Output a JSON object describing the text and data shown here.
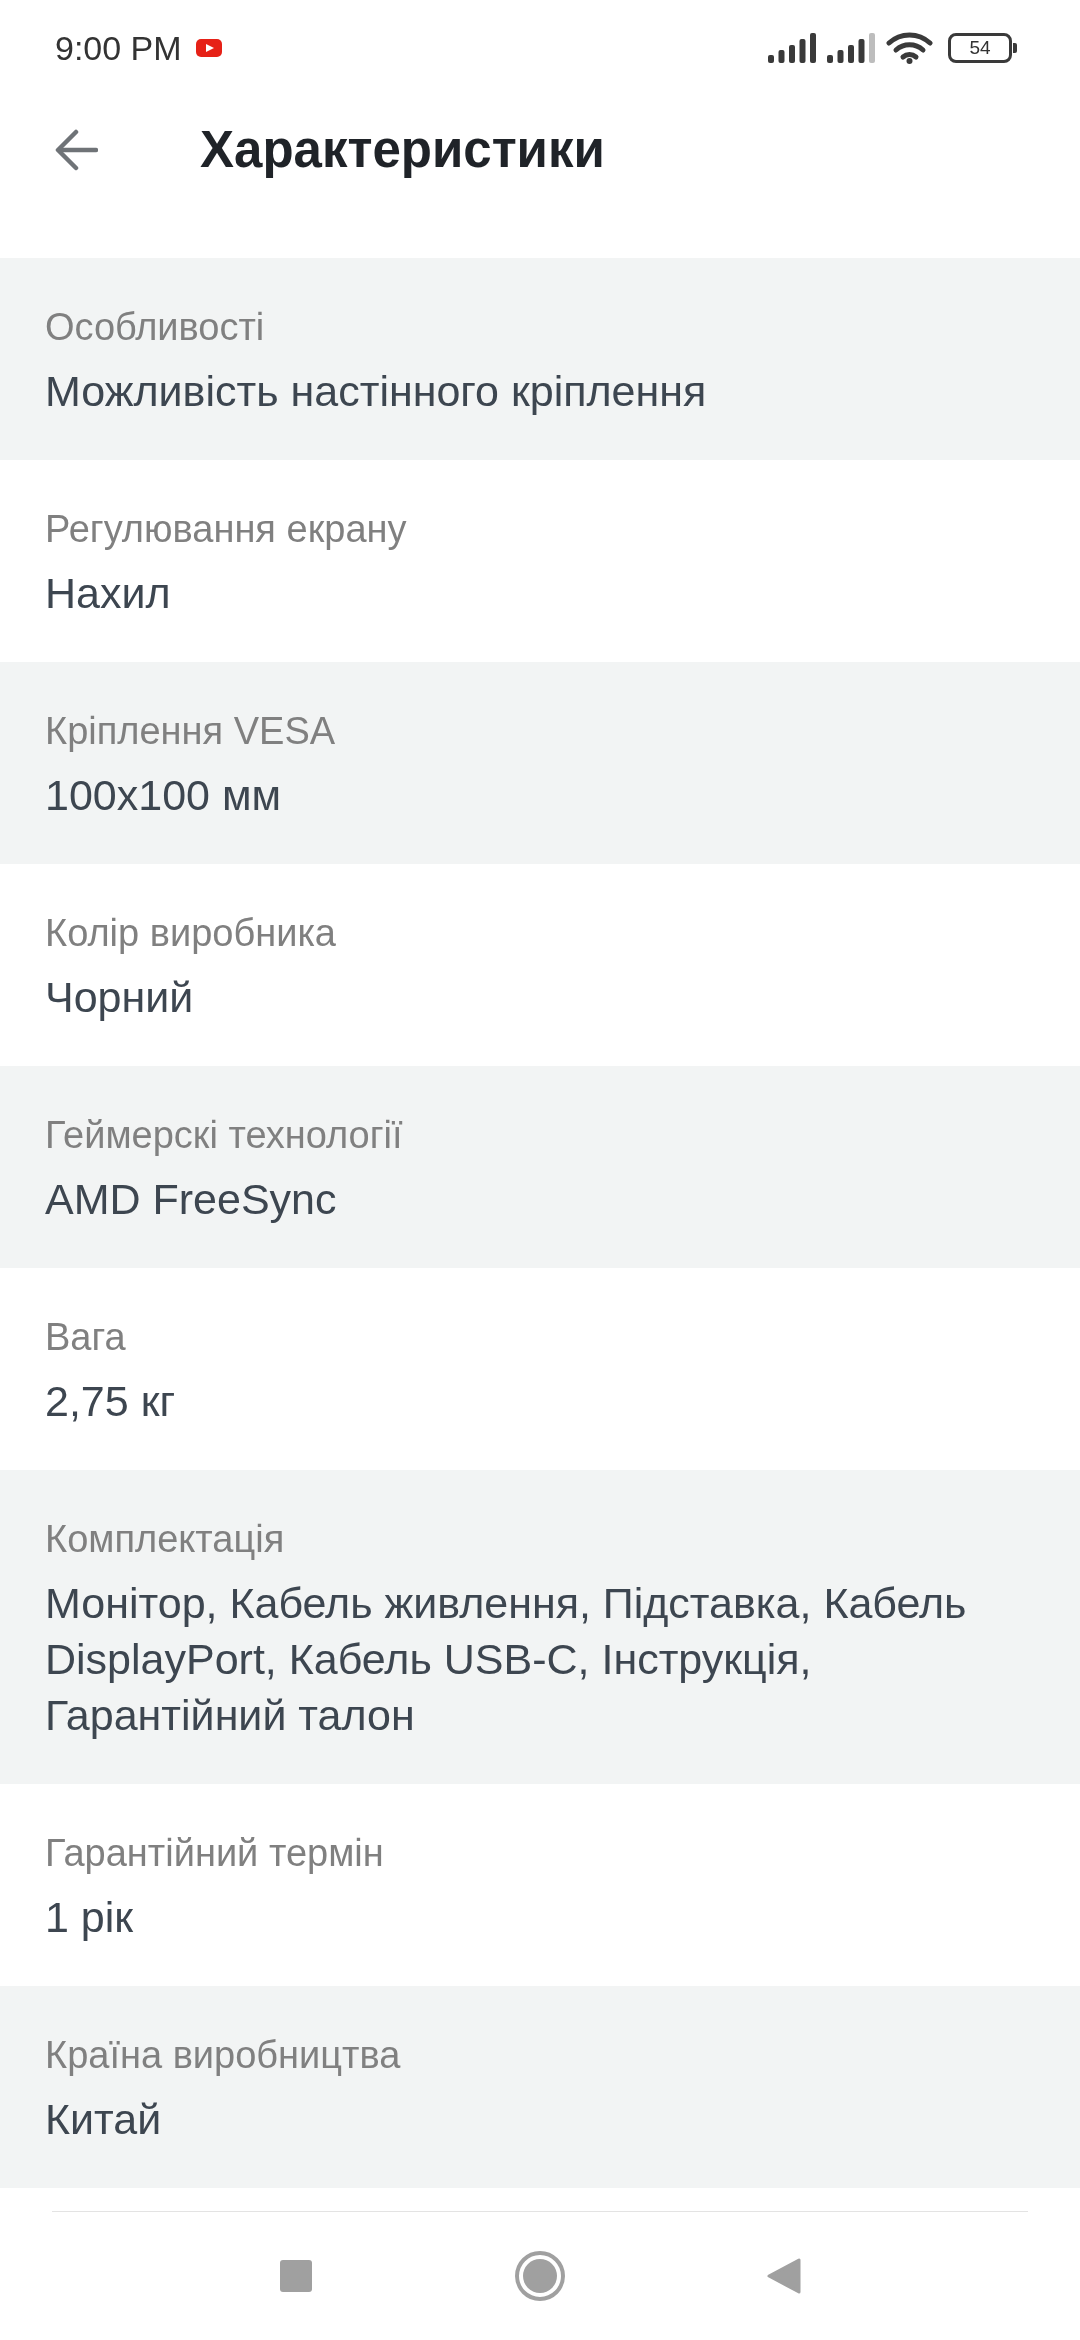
{
  "status_bar": {
    "time": "9:00 PM",
    "battery": "54"
  },
  "header": {
    "title": "Характеристики"
  },
  "specs": [
    {
      "label": "Особливості",
      "value": "Можливість настінного кріплення"
    },
    {
      "label": "Регулювання екрану",
      "value": "Нахил"
    },
    {
      "label": "Кріплення VESA",
      "value": "100x100 мм"
    },
    {
      "label": "Колір виробника",
      "value": "Чорний"
    },
    {
      "label": "Геймерскі технології",
      "value": "AMD FreeSync"
    },
    {
      "label": "Вага",
      "value": "2,75 кг"
    },
    {
      "label": "Комплектація",
      "value": "Монітор, Кабель живлення, Підставка, Кабель DisplayPort, Кабель USB-C, Інструкція, Гарантійний талон"
    },
    {
      "label": "Гарантійний термін",
      "value": "1 рік"
    },
    {
      "label": "Країна виробництва",
      "value": "Китай"
    }
  ]
}
